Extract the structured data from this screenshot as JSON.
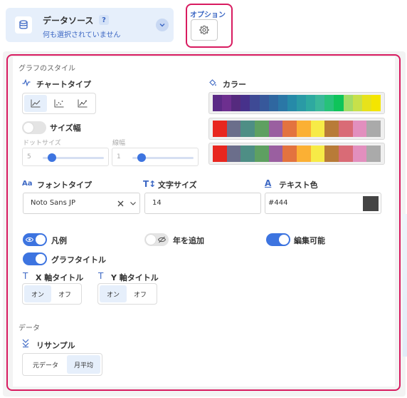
{
  "datasource": {
    "title": "データソース",
    "help": "?",
    "subtitle": "何も選択されていません"
  },
  "options": {
    "label": "オプション"
  },
  "graph_style": {
    "section_title": "グラフのスタイル",
    "chart_type_label": "チャートタイプ",
    "color_label": "カラー",
    "size_toggle_label": "サイズ幅",
    "dot_size_label": "ドットサイズ",
    "dot_size_value": "5",
    "line_width_label": "線幅",
    "line_width_value": "1",
    "font_type_label": "フォントタイプ",
    "font_type_value": "Noto Sans JP",
    "font_size_label": "文字サイズ",
    "font_size_value": "14",
    "text_color_label": "テキスト色",
    "text_color_value": "#444",
    "legend_label": "凡例",
    "add_year_label": "年を追加",
    "editable_label": "編集可能",
    "graph_title_label": "グラフタイトル",
    "x_axis_title_label": "X 軸タイトル",
    "y_axis_title_label": "Y 軸タイトル",
    "on_label": "オン",
    "off_label": "オフ",
    "x_on_label": "オン",
    "x_off_label": "オフ",
    "y_on_label": "オン",
    "y_off_label": "オフ"
  },
  "data_section": {
    "section_title": "データ",
    "resample_label": "リサンプル",
    "raw_label": "元データ",
    "monthly_label": "月平均"
  },
  "palettes": [
    [
      "#5b2a86",
      "#6d2f8f",
      "#552a7e",
      "#47318b",
      "#3e4a95",
      "#37589b",
      "#2f67a0",
      "#2a77a6",
      "#268aa8",
      "#2a9aa5",
      "#2ea9a0",
      "#3ab89a",
      "#27c27a",
      "#0ec45a",
      "#a2dc66",
      "#c7e04a",
      "#e7e21b",
      "#f4e500"
    ],
    [
      "#e8261f",
      "#6b6e8b",
      "#4e8e85",
      "#5ea061",
      "#9a5fa0",
      "#e3733f",
      "#fbb034",
      "#f7eb47",
      "#b87b38",
      "#d96b76",
      "#e28fbe",
      "#aaaaaa"
    ],
    [
      "#e8261f",
      "#6b6e8b",
      "#4e8e85",
      "#5ea061",
      "#9a5fa0",
      "#e3733f",
      "#fbb034",
      "#f7eb47",
      "#b87b38",
      "#d96b76",
      "#e28fbe",
      "#aaaaaa"
    ]
  ],
  "colors": {
    "accent": "#3d74e0",
    "highlight": "#d81b60",
    "swatch": "#444444"
  },
  "icons": {
    "datasource": "database-icon",
    "options": "gear-icon",
    "chart_type": "pulse-icon",
    "color": "paint-bucket-icon",
    "font_type": "text-aa-icon",
    "font_size": "text-size-icon",
    "text_color": "text-color-icon",
    "axis_title": "text-t-icon",
    "resample": "resample-icon"
  }
}
